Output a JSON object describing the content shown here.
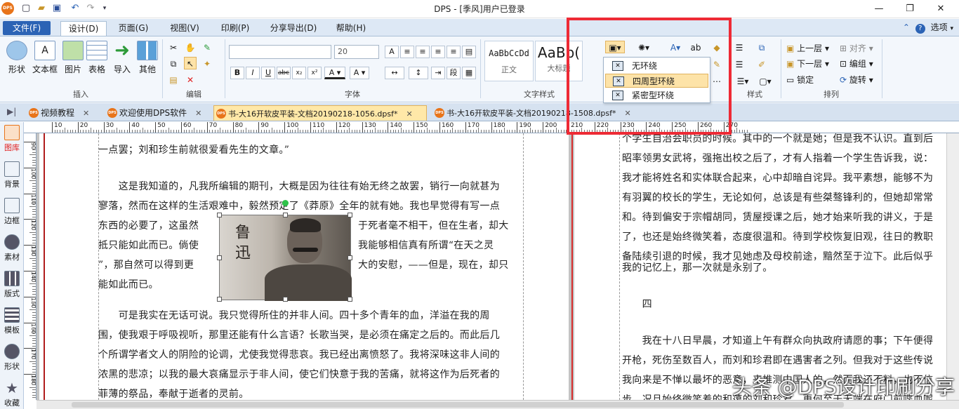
{
  "window": {
    "title": "DPS - [季风]用户已登录",
    "logo": "DPS"
  },
  "menu": {
    "file": "文件(F)",
    "tabs": [
      "设计(D)",
      "页面(G)",
      "视图(V)",
      "印刷(P)",
      "分享导出(D)",
      "帮助(H)"
    ],
    "right_label": "选项"
  },
  "ribbon": {
    "insert": {
      "title": "插入",
      "buttons": [
        "形状",
        "文本框",
        "图片",
        "表格",
        "导入",
        "其他"
      ]
    },
    "edit": {
      "title": "编辑"
    },
    "font": {
      "title": "字体",
      "size": "20"
    },
    "textstyle": {
      "title": "文字样式",
      "samples": [
        {
          "preview": "AaBbCcDd",
          "label": "正文"
        },
        {
          "preview": "AaBb(",
          "label": "大标题"
        }
      ]
    },
    "style": {
      "title": "样式"
    },
    "arrange": {
      "title": "排列",
      "items": [
        "上一层",
        "对齐",
        "下一层",
        "编组",
        "锁定",
        "旋转"
      ]
    }
  },
  "wrap_menu": {
    "items": [
      "无环绕",
      "四周型环绕",
      "紧密型环绕"
    ],
    "selected": "四周型环绕"
  },
  "doc_tabs": [
    {
      "label": "视频教程",
      "active": false
    },
    {
      "label": "欢迎使用DPS软件",
      "active": false
    },
    {
      "label": "书-大16开软皮平装-文档20190218-1056.dpsf*",
      "active": true
    },
    {
      "label": "书-大16开软皮平装-文档20190218-1508.dpsf*",
      "active": false
    }
  ],
  "left_panel": [
    "图库",
    "背景",
    "边框",
    "素材",
    "版式",
    "模板",
    "形状",
    "收藏"
  ],
  "ruler": {
    "h_ticks": [
      "10",
      "20",
      "30",
      "40",
      "50",
      "60",
      "70",
      "80",
      "90",
      "100",
      "110",
      "120",
      "130",
      "140",
      "150",
      "160",
      "170",
      "180",
      "190",
      "200",
      "210",
      "220",
      "230",
      "240",
      "250",
      "260",
      "270"
    ],
    "v_ticks": [
      "90",
      "100",
      "110",
      "120",
      "130",
      "140",
      "150",
      "160",
      "170",
      "180"
    ]
  },
  "page_left": {
    "lines": [
      "一点罢；刘和珍生前就很爱看先生的文章。”",
      "　　这是我知道的，凡我所编辑的期刊，大概是因为往往有始无终之故罢，销行一向就甚为",
      "寥落，然而在这样的生活艰难中，毅然预定了《莽原》全年的就有她。我也早觉得有写一点",
      "东西的必要了，这虽然",
      "抵只能如此而已。倘使",
      "”，那自然可以得到更",
      "能如此而已。",
      "于死者毫不相干，但在生者，却大",
      "我能够相信真有所谓“在天之灵",
      "大的安慰，——但是，现在，却只",
      "　　可是我实在无话可说。我只觉得所住的并非人间。四十多个青年的血，洋溢在我的周",
      "围，使我艰于呼吸视听，那里还能有什么言语？长歌当哭，是必须在痛定之后的。而此后几",
      "个所谓学者文人的阴险的论调，尤使我觉得悲哀。我已经出离愤怒了。我将深味这非人间的",
      "浓黑的悲凉；以我的最大哀痛显示于非人间，使它们快意于我的苦痛，就将这作为后死者的",
      "菲薄的祭品，奉献于逝者的灵前。"
    ],
    "image_caption": "鲁 迅"
  },
  "page_right": {
    "lines": [
      "个学生自治会职员的时候。其中的一个就是她；但是我不认识。直到后",
      "昭率领男女武将，强拖出校之后了，才有人指着一个学生告诉我，说：",
      "我才能将姓名和实体联合起来，心中却暗自诧异。我平素想，能够不为",
      "有羽翼的校长的学生，无论如何，总该是有些桀骜锋利的，但她却常常",
      "和。待到偏安于宗帽胡同，赁屋授课之后，她才始来听我的讲义，于是",
      "了，也还是始终微笑着，态度很温和。待到学校恢复旧观，往日的教职",
      "备陆续引退的时候，我才见她虑及母校前途，黯然至于泣下。此后似乎",
      "我的记忆上，那一次就是永别了。",
      "　　四",
      "　　我在十八日早晨，才知道上午有群众向执政府请愿的事；下午便得",
      "开枪，死伤至数百人，而刘和珍君即在遇害者之列。但我对于这些传说",
      "我向来是不惮以最坏的恶意，来推测中国人的，然而我还不料，也不信",
      "步。况且始终微笑着的和蔼的刘和珍君，更何至于无端在府门前喋血呢"
    ]
  },
  "watermark": "头条 @DPS设计印刷分享",
  "colors": {
    "accent_red": "#ee2a35",
    "file_tab": "#2b63b5",
    "active_tab": "#ffe8a8",
    "logo": "#e8741a"
  }
}
